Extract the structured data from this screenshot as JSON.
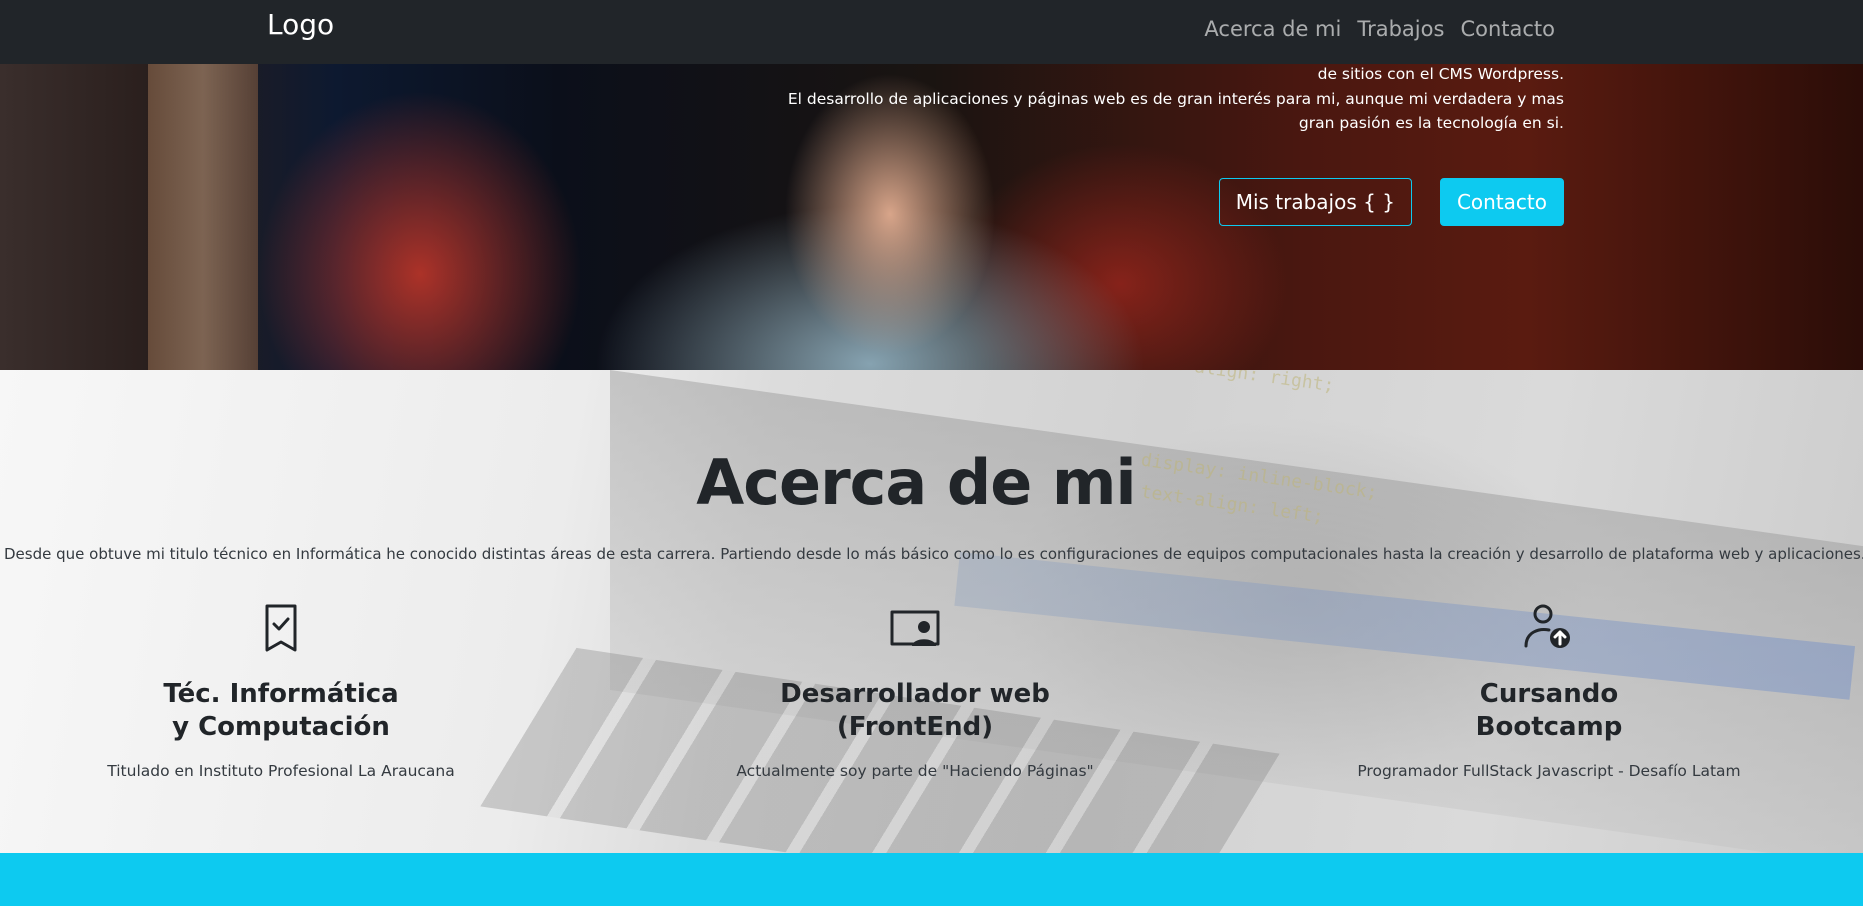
{
  "navbar": {
    "brand": "Logo",
    "links": [
      "Acerca de mi",
      "Trabajos",
      "Contacto"
    ]
  },
  "hero": {
    "lines": [
      "de sitios con el CMS Wordpress.",
      "El desarrollo de aplicaciones y páginas web es de gran interés para mi, aunque mi verdadera y mas",
      "gran pasión es la tecnología en si."
    ],
    "buttons": {
      "works_label": "Mis trabajos { }",
      "contact_label": "Contacto"
    }
  },
  "about": {
    "title": "Acerca de mi",
    "description": "Desde que obtuve mi titulo técnico en Informática he conocido distintas áreas de esta carrera. Partiendo desde lo más básico como lo es configuraciones de equipos computacionales hasta la creación y desarrollo de plataforma web y aplicaciones.",
    "features": [
      {
        "icon": "bookmark-check-icon",
        "title_line1": "Téc. Informática",
        "title_line2": "y Computación",
        "text": "Titulado en Instituto Profesional La Araucana"
      },
      {
        "icon": "person-video-icon",
        "title_line1": "Desarrollador web",
        "title_line2": "(FrontEnd)",
        "text": "Actualmente soy parte de \"Haciendo Páginas\""
      },
      {
        "icon": "person-up-icon",
        "title_line1": "Cursando",
        "title_line2": "Bootcamp",
        "text": "Programador FullStack Javascript - Desafío Latam"
      }
    ],
    "background_code": [
      "text-align: right;",
      "display: inline-block;",
      "text-align: left;"
    ]
  },
  "colors": {
    "navbar": "#212529",
    "accent": "#0dcaf0",
    "text": "#212529"
  }
}
